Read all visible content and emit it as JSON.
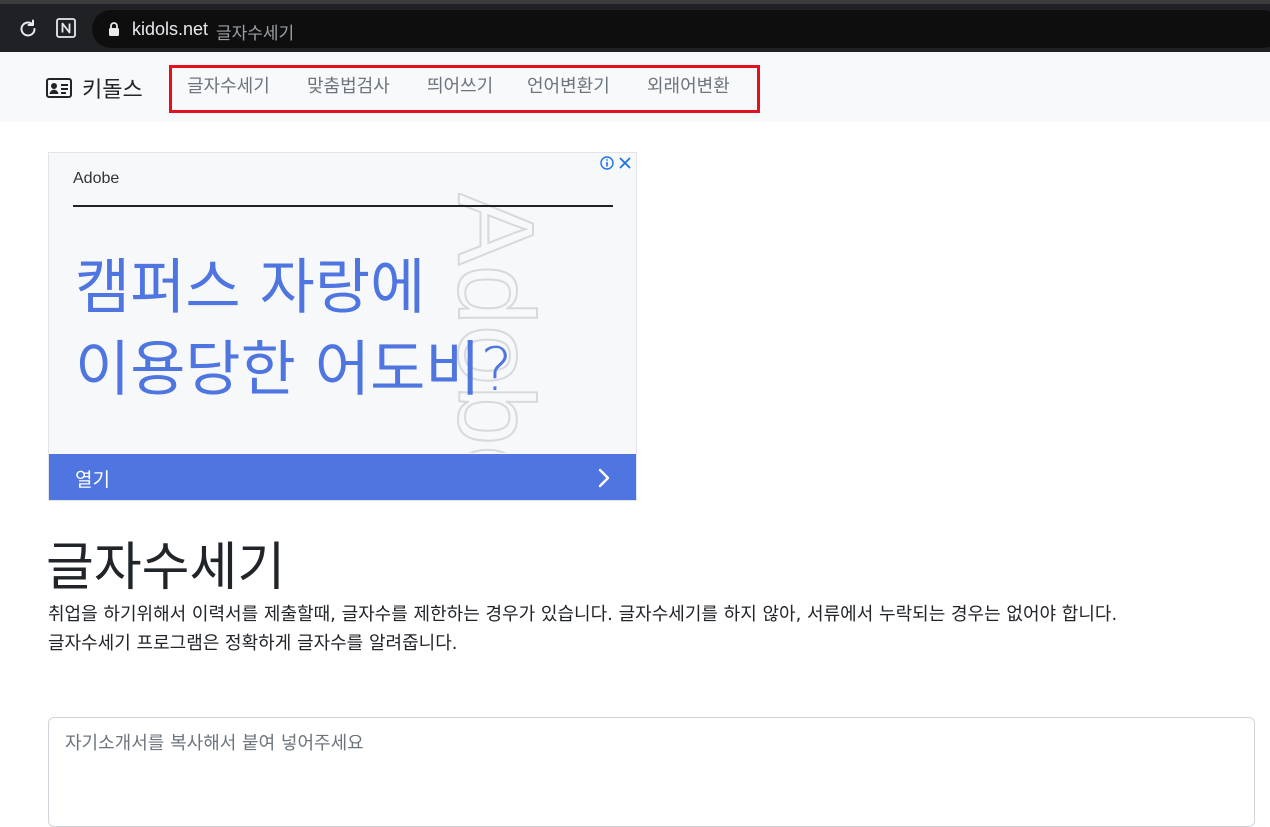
{
  "browser": {
    "url_host": "kidols.net",
    "tab_title": "글자수세기",
    "icons": [
      "reload-icon",
      "notion-icon",
      "lock-icon"
    ]
  },
  "navbar": {
    "brand": "키돌스",
    "brand_icon": "id-card-icon",
    "links": [
      {
        "label": "글자수세기"
      },
      {
        "label": "맞춤법검사"
      },
      {
        "label": "띄어쓰기"
      },
      {
        "label": "언어변환기"
      },
      {
        "label": "외래어변환"
      }
    ],
    "highlight_color": "#e3101e"
  },
  "ad": {
    "brand": "Adobe",
    "headline_line1": "캠퍼스 자랑에",
    "headline_line2": "이용당한 어도비?",
    "watermark": "Adobe",
    "cta_label": "열기",
    "accent_color": "#4f76e0",
    "icons": [
      "info-icon",
      "close-icon",
      "chevron-right-icon"
    ]
  },
  "main": {
    "title": "글자수세기",
    "desc_line1": "취업을 하기위해서 이력서를 제출할때, 글자수를 제한하는 경우가 있습니다. 글자수세기를 하지 않아, 서류에서 누락되는 경우는 없어야 합니다.",
    "desc_line2": "글자수세기 프로그램은 정확하게 글자수를 알려줍니다.",
    "textarea_placeholder": "자기소개서를 복사해서 붙여 넣어주세요"
  }
}
